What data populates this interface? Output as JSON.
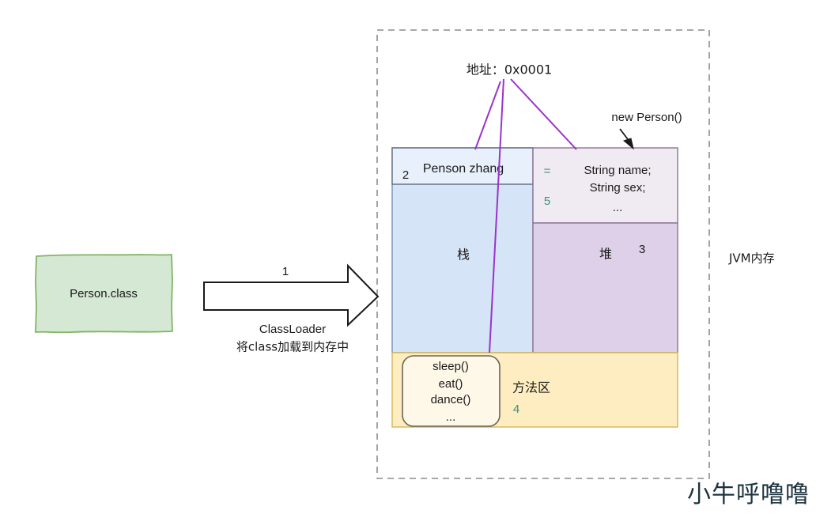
{
  "diagram": {
    "title_label": "JVM内存",
    "watermark": "小牛呼噜噜",
    "source_box": {
      "label": "Person.class",
      "fill": "#d5e8d4",
      "stroke": "#82b366"
    },
    "loader_arrow": {
      "step_number": "1",
      "caption_line1": "ClassLoader",
      "caption_line2": "将class加载到内存中"
    },
    "address_annotation": {
      "label": "地址：0x0001",
      "line_color": "#9933cc"
    },
    "new_object_annotation": {
      "label": "new Person()"
    },
    "stack": {
      "region_label": "栈",
      "step_number": "2",
      "frame_label": "Penson zhang",
      "fill": "#d6e4f7",
      "header_fill": "#e8f1fb",
      "stroke": "#7591b5"
    },
    "heap": {
      "region_label": "堆",
      "step_number": "3",
      "fill": "#ddd0e8",
      "stroke": "#8b7295",
      "object_box": {
        "fill": "#f0ebf2",
        "assign_symbol": "=",
        "assign_step": "5",
        "fields": [
          "String name;",
          "String sex;",
          "..."
        ]
      }
    },
    "method_area": {
      "region_label": "方法区",
      "step_number": "4",
      "fill": "#fdedc0",
      "stroke": "#d6b656",
      "methods_box": {
        "fill": "#fdf8e8",
        "stroke": "#6d6456",
        "methods": [
          "sleep()",
          "eat()",
          "dance()",
          "..."
        ]
      }
    }
  }
}
